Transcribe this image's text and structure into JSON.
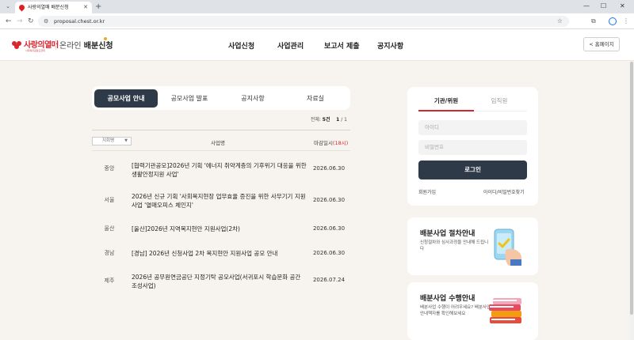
{
  "browser": {
    "tab_title": "사랑의열매 배분신청",
    "url": "proposal.chest.or.kr",
    "new_tab_symbol": "+",
    "minimize": "—",
    "maximize": "☐",
    "close": "✕"
  },
  "header": {
    "logo_text": "사랑의열매",
    "logo_sub": "사회복지공동모금회",
    "online_prefix": "온라인",
    "online_service": "배분신청",
    "nav": [
      "사업신청",
      "사업관리",
      "보고서 제출",
      "공지사항"
    ],
    "home_button": "< 홈페이지"
  },
  "content_tabs": [
    "공모사업 안내",
    "공모사업 발표",
    "공지사항",
    "자료실"
  ],
  "list": {
    "total_label": "전체:",
    "total_count": "5건",
    "page": "1",
    "page_total": "/ 1",
    "region_select": "지회명",
    "col_title": "사업명",
    "col_deadline": "마감일시",
    "col_deadline_time": "(18시)",
    "rows": [
      {
        "region": "중앙",
        "title": "[협력기관공모]2026년 기획 '에너지 취약계층의 기후위기 대응을 위한 생활안정지원 사업'",
        "date": "2026.06.30"
      },
      {
        "region": "서울",
        "title": "2026년 신규 기획 '사회복지현장 업무효율 증진을 위한 사무기기 지원사업 '열매오피스 체인지'",
        "date": "2026.06.30"
      },
      {
        "region": "울산",
        "title": "[울산]2026년 지역복지현안 지원사업(2차)",
        "date": "2026.06.30"
      },
      {
        "region": "경남",
        "title": "[경남] 2026년 신청사업 2차 복지현안 지원사업 공모 안내",
        "date": "2026.06.30"
      },
      {
        "region": "제주",
        "title": "2026년 공무원연금공단 지정기탁 공모사업(서귀포시 학습문화 공간 조성사업)",
        "date": "2026.07.24"
      }
    ]
  },
  "login": {
    "tab_org": "기관/위원",
    "tab_staff": "임직원",
    "id_placeholder": "아이디",
    "pw_placeholder": "비밀번호",
    "login_button": "로그인",
    "join_link": "회원가입",
    "find_link": "아이디/비밀번호찾기"
  },
  "info_cards": [
    {
      "title": "배분사업 절차안내",
      "desc": "신청절차와 심사과정을 안내해 드립니다",
      "icon": "phone-check-icon"
    },
    {
      "title": "배분사업 수행안내",
      "desc": "배분사업 수행이 어려우세요? 배분사업안내책자를 확인해보세요",
      "icon": "books-icon"
    }
  ],
  "colors": {
    "brand_red": "#d7262f",
    "dark_navy": "#2e3a47",
    "page_bg": "#f7f3ee"
  }
}
